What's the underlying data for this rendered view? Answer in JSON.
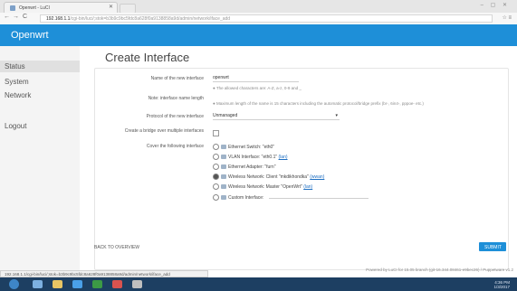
{
  "browser": {
    "tab_title": "Openwrt - LuCI",
    "url_host": "192.168.1.1",
    "url_path": "/cgi-bin/luci/;stok=b3b9c9bc5fdc8a628f0a9138858a9d/admin/network/iface_add",
    "status_url": "192.168.1.1/cgi-bin/luci/;stok=b3b9c9bc5fdc8a628f0a9138858a9d/admin/network/iface_add"
  },
  "header": {
    "brand": "Openwrt"
  },
  "sidebar": {
    "items": [
      {
        "label": "Status"
      },
      {
        "label": "System"
      },
      {
        "label": "Network"
      },
      {
        "label": "Logout"
      }
    ]
  },
  "main": {
    "title": "Create Interface",
    "form": {
      "name_label": "Name of the new interface",
      "name_value": "openwrt",
      "name_help": "The allowed characters are: A-Z, a-z, 0-9 and _",
      "note_label": "Note: interface name length",
      "note_help": "Maximum length of the name is 15 characters including the automatic protocol/bridge prefix (br-, 6in4-, pppoe- etc.)",
      "protocol_label": "Protocol of the new interface",
      "protocol_value": "Unmanaged",
      "bridge_label": "Create a bridge over multiple interfaces",
      "cover_label": "Cover the following interface",
      "options": [
        {
          "text": "Ethernet Switch: \"eth0\"",
          "link": "",
          "selected": false
        },
        {
          "text": "VLAN Interface: \"eth0.1\"",
          "link": "(lan)",
          "selected": false
        },
        {
          "text": "Ethernet Adapter: \"furn\"",
          "link": "",
          "selected": false
        },
        {
          "text": "Wireless Network: Client \"mkdikhondka\"",
          "link": "(wwan)",
          "selected": true
        },
        {
          "text": "Wireless Network: Master \"OpenWrt\"",
          "link": "(lan)",
          "selected": false
        },
        {
          "text": "Custom Interface:",
          "link": "",
          "selected": false
        }
      ]
    },
    "back_label": "BACK TO OVERVIEW",
    "submit_label": "SUBMIT",
    "powered_by": "Powered by LuCI for 15.05 branch (git-16.344.08461-e9bec26) / Puppetware v1.2"
  },
  "taskbar": {
    "time": "4:36 PM",
    "date": "1/3/2017"
  }
}
